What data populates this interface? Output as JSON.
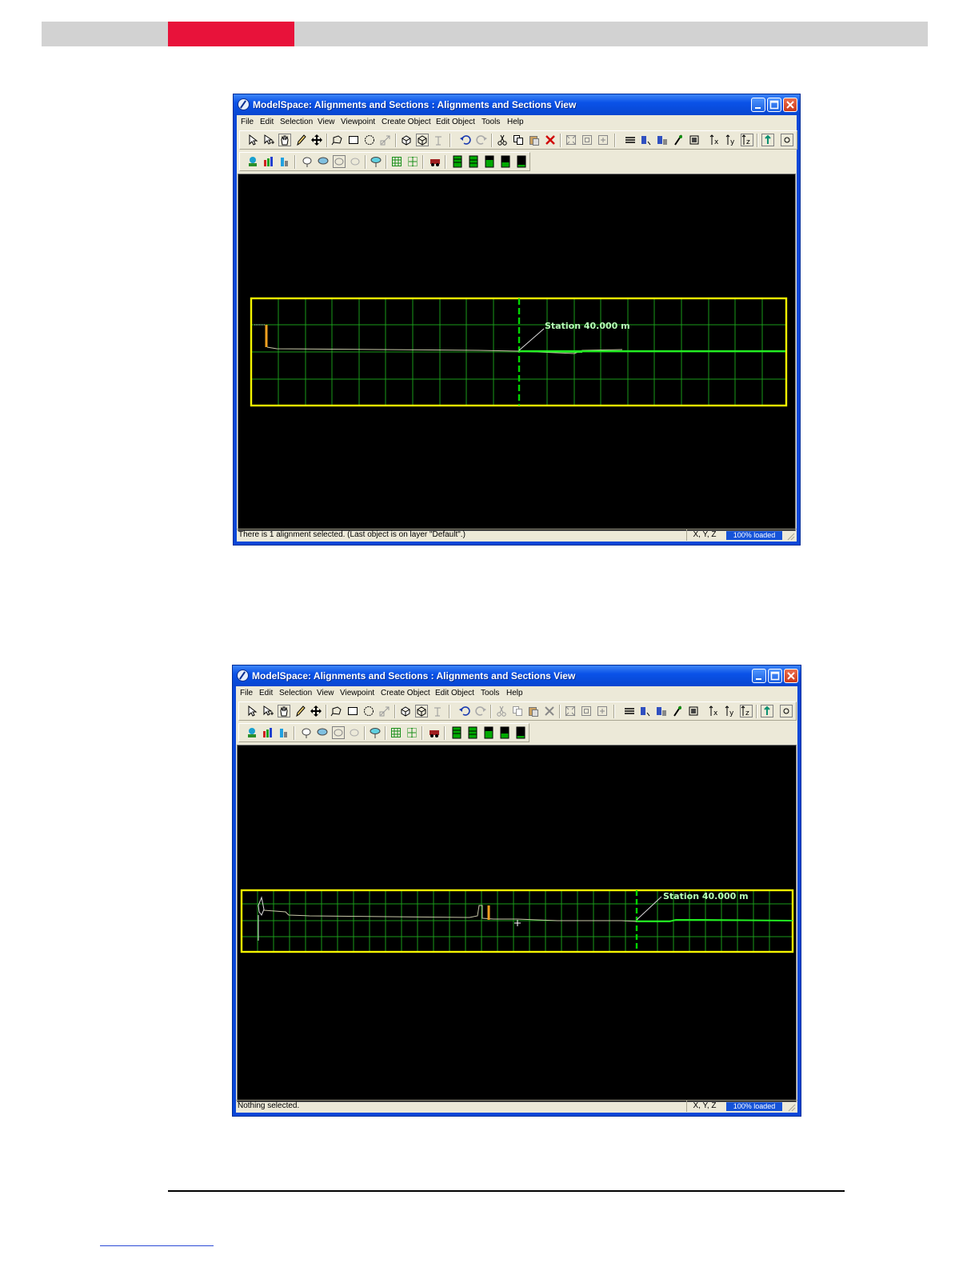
{
  "window_title": "ModelSpace: Alignments and Sections : Alignments and Sections View",
  "menu": [
    "File",
    "Edit",
    "Selection",
    "View",
    "Viewpoint",
    "Create Object",
    "Edit Object",
    "Tools",
    "Help"
  ],
  "toolbar1_icons": [
    "select-arrow-icon",
    "select-add-icon",
    "pan-hand-icon",
    "pencil-icon",
    "move-icon",
    "lasso-icon",
    "rectangle-select-icon",
    "circle-select-icon",
    "stretch-icon",
    "cube-icon",
    "box-icon",
    "fence-icon",
    "undo-icon",
    "redo-icon",
    "cut-icon",
    "copy-icon",
    "paste-icon",
    "delete-icon",
    "zoom-extents-icon",
    "zoom-window-icon",
    "zoom-all-icon",
    "layers-icon",
    "edit-layer-icon",
    "object-icon",
    "survey-icon",
    "station-icon",
    "tx-icon",
    "ty-icon",
    "tz-icon",
    "level-icon",
    "settings-icon"
  ],
  "toolbar2_icons": [
    "scan-icon",
    "colors-icon",
    "elevation-icon",
    "registration-icon",
    "cloud-icon",
    "hand-cloud-icon",
    "hide-cloud-icon",
    "target-icon",
    "grid-points-icon",
    "grid-dots-icon",
    "vehicle-icon",
    "level1-icon",
    "level2-icon",
    "level3-icon",
    "level4-icon",
    "level5-icon"
  ],
  "label_station": "Station 40.000 m",
  "status_xyz": "X, Y, Z",
  "status_loaded": "100% loaded",
  "view1": {
    "status_message": "There is 1 alignment selected. (Last object is on layer \"Default\".)"
  },
  "view2": {
    "status_message": "Nothing selected."
  },
  "colors": {
    "red_band": "#e8123a",
    "frame": "#f4f400",
    "grid": "#1a9a1a",
    "station_line": "#00d400",
    "profile": "#33ff33",
    "selected": "#f0a020",
    "titlebar": "#0a52e8"
  }
}
